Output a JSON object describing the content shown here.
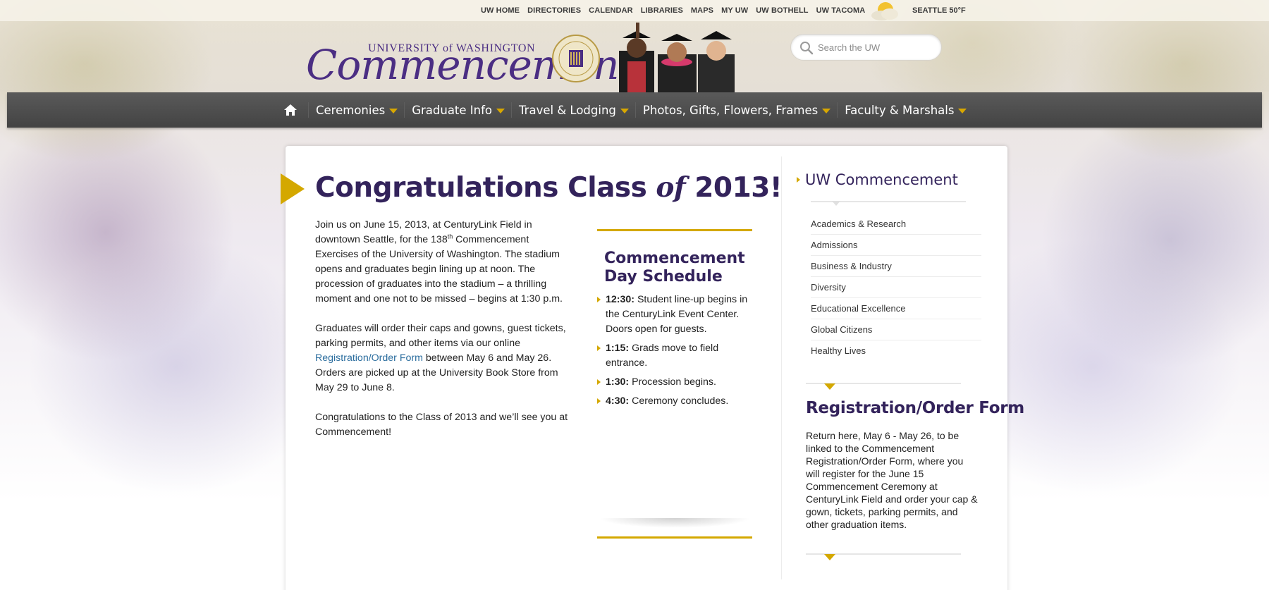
{
  "topbar": {
    "links": [
      "UW HOME",
      "DIRECTORIES",
      "CALENDAR",
      "LIBRARIES",
      "MAPS",
      "MY UW",
      "UW BOTHELL",
      "UW TACOMA"
    ],
    "weather_icon": "partly-sunny-icon",
    "weather_text": "SEATTLE 50°F"
  },
  "header": {
    "logo_university": "UNIVERSITY of WASHINGTON",
    "logo_title": "Commencement",
    "search_placeholder": "Search the UW"
  },
  "nav": {
    "home_icon": "home-icon",
    "items": [
      "Ceremonies",
      "Graduate Info",
      "Travel & Lodging",
      "Photos, Gifts, Flowers, Frames",
      "Faculty & Marshals"
    ]
  },
  "main": {
    "headline_pre": "Congratulations Class ",
    "headline_of": "of",
    "headline_post": " 2013!",
    "para1_a": "Join us on June 15, 2013, at CenturyLink Field in downtown Seattle, for the 138",
    "para1_sup": "th",
    "para1_b": " Commencement Exercises of the University of Washington. The stadium opens and graduates begin lining up at noon. The procession of graduates into the stadium – a thrilling moment and one not to be missed – begins at 1:30 p.m.",
    "para2_a": "Graduates will order their caps and gowns, guest tickets, parking permits, and other items via our online ",
    "para2_link": "Registration/Order Form",
    "para2_b": " between May 6 and May 26. Orders are picked up at the University Book Store from May 29 to June 8.",
    "para3": "Congratulations to the Class of 2013 and we’ll see you at Commencement!"
  },
  "schedule": {
    "title": "Commencement Day Schedule",
    "items": [
      {
        "time": "12:30:",
        "text": " Student line-up begins in the CenturyLink Event Center. Doors open for guests."
      },
      {
        "time": "1:15:",
        "text": " Grads move to field entrance."
      },
      {
        "time": "1:30:",
        "text": " Procession begins."
      },
      {
        "time": "4:30:",
        "text": " Ceremony concludes."
      }
    ]
  },
  "sidebar": {
    "heading": "UW Commencement",
    "items": [
      "Academics & Research",
      "Admissions",
      "Business & Industry",
      "Diversity",
      "Educational Excellence",
      "Global Citizens",
      "Healthy Lives"
    ],
    "reg_title": "Registration/Order Form",
    "reg_text": "Return here, May 6 - May 26, to be linked to the Commencement Registration/Order Form, where you will register for the June 15 Commencement Ceremony at CenturyLink Field and order your cap & gown, tickets, parking permits, and other graduation items."
  },
  "colors": {
    "uw_purple": "#4b2e83",
    "heading_purple": "#33235b",
    "gold": "#d4a800",
    "nav_bg": "#4a4a4a",
    "link_blue": "#2b6d9e"
  }
}
